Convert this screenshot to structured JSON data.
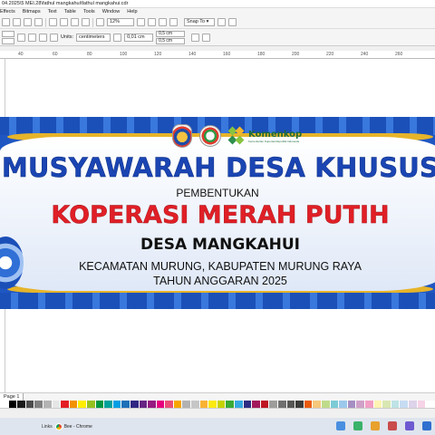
{
  "window": {
    "title": "04.2025\\5 MEI.28\\fathul mangkahui\\fathul mangkahui.cdr"
  },
  "menu": [
    "Effects",
    "Bitmaps",
    "Text",
    "Table",
    "Tools",
    "Window",
    "Help"
  ],
  "toolbar": {
    "zoom": "12%",
    "snap_to": "Snap To",
    "snap_arrow": "▾"
  },
  "propbar": {
    "units_label": "Units:",
    "units_value": "centimeters",
    "nudge": "0,01 cm",
    "dup_x": "0,5 cm",
    "dup_y": "0,5 cm"
  },
  "ruler": {
    "ticks": [
      "40",
      "60",
      "80",
      "100",
      "120",
      "140",
      "160",
      "180",
      "200",
      "220",
      "240",
      "260"
    ]
  },
  "banner": {
    "title": "MUSYAWARAH DESA KHUSUS",
    "subtitle": "PEMBENTUKAN",
    "headline": "KOPERASI MERAH PUTIH",
    "village": "DESA MANGKAHUI",
    "district": "KECAMATAN MURUNG, KABUPATEN MURUNG RAYA",
    "year": "TAHUN ANGGARAN 2025",
    "logo_brand": "Komenkop",
    "logo_brand_sub": "Kementerian Koperasi Republik Indonesia",
    "colors": {
      "title": "#1a45b3",
      "headline": "#e01f26",
      "accent": "#e6b42a",
      "frame": "#1f57c2"
    }
  },
  "page_tab": "Page 1",
  "palette": [
    "#ffffff",
    "#000000",
    "#1a1a1a",
    "#4d4d4d",
    "#808080",
    "#b3b3b3",
    "#e6e6e6",
    "#e31e24",
    "#f39200",
    "#ffed00",
    "#95c11f",
    "#009640",
    "#00a19a",
    "#009fe3",
    "#1d71b8",
    "#312783",
    "#662483",
    "#951b81",
    "#e6007e",
    "#e94e77",
    "#f7a600",
    "#b2b2b2",
    "#c6c6c6",
    "#f9b233",
    "#fcea10",
    "#c6d300",
    "#3aaa35",
    "#36a9e1",
    "#2d2e83",
    "#a2195b",
    "#be1622",
    "#9d9d9c",
    "#706f6f",
    "#575756",
    "#3c3c3b",
    "#ea5b0c",
    "#f6c87b",
    "#bfdb8a",
    "#7ccbd5",
    "#9bc9ec",
    "#a58fc2",
    "#d0a1c8",
    "#f29fc5",
    "#fff3b2",
    "#d9e7b2",
    "#bee3e6",
    "#c6dcf2",
    "#ddd3ea",
    "#f6d3e7",
    "#ffffff"
  ],
  "taskbar": {
    "links": "Links",
    "chrome_label": "Bee - Chrome",
    "tray_colors": [
      "#4a8fe0",
      "#3bb26a",
      "#e8a12c",
      "#c94b4b",
      "#6d5ad0",
      "#2f6fcf"
    ]
  }
}
